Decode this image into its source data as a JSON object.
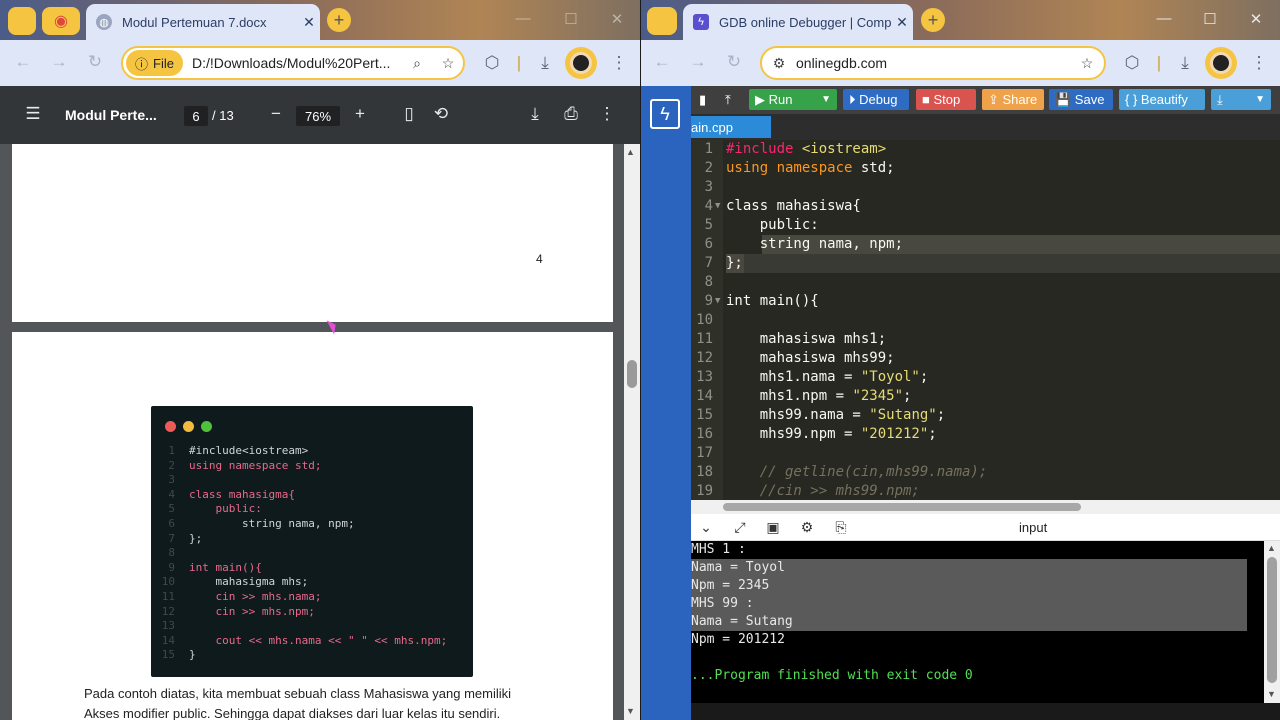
{
  "left": {
    "tab": {
      "title": "Modul Pertemuan 7.docx",
      "close": "✕"
    },
    "address": {
      "chip": "File",
      "url": "D:/!Downloads/Modul%20Pert..."
    },
    "pdf": {
      "doc_title": "Modul Perte...",
      "page_current": "6",
      "page_total": "/ 13",
      "zoom": "76%",
      "page_number_label": "4",
      "code_lines": [
        {
          "n": "1",
          "t": "#include<iostream>"
        },
        {
          "n": "2",
          "t": "using namespace std;"
        },
        {
          "n": "3",
          "t": ""
        },
        {
          "n": "4",
          "t": "class mahasigma{"
        },
        {
          "n": "5",
          "t": "    public:"
        },
        {
          "n": "6",
          "t": "        string nama, npm;"
        },
        {
          "n": "7",
          "t": "};"
        },
        {
          "n": "8",
          "t": ""
        },
        {
          "n": "9",
          "t": "int main(){"
        },
        {
          "n": "10",
          "t": "    mahasigma mhs;"
        },
        {
          "n": "11",
          "t": "    cin >> mhs.nama;"
        },
        {
          "n": "12",
          "t": "    cin >> mhs.npm;"
        },
        {
          "n": "13",
          "t": ""
        },
        {
          "n": "14",
          "t": "    cout << mhs.nama << \" \" << mhs.npm;"
        },
        {
          "n": "15",
          "t": "}"
        }
      ],
      "paragraph_line1": "Pada contoh diatas, kita membuat sebuah class Mahasiswa yang memiliki",
      "paragraph_line2": "Akses modifier public. Sehingga dapat diakses dari luar kelas itu sendiri."
    }
  },
  "right": {
    "tab": {
      "title": "GDB online Debugger | Compil",
      "close": "✕"
    },
    "address": {
      "url": "onlinegdb.com"
    },
    "toolbar": {
      "run": "▶ Run",
      "debug": "⏵ Debug",
      "stop": "■ Stop",
      "share": "⇪ Share",
      "save": "💾 Save",
      "beautify": "{ } Beautify"
    },
    "file_tab": "ain.cpp",
    "editor_lines": [
      {
        "n": "1",
        "parts": [
          {
            "c": "k",
            "t": "#include "
          },
          {
            "c": "s",
            "t": "<iostream>"
          }
        ]
      },
      {
        "n": "2",
        "parts": [
          {
            "c": "o",
            "t": "using namespace "
          },
          {
            "c": "pp",
            "t": "std;"
          }
        ]
      },
      {
        "n": "3",
        "parts": []
      },
      {
        "n": "4",
        "parts": [
          {
            "c": "pp",
            "t": "class mahasiswa{"
          }
        ]
      },
      {
        "n": "5",
        "parts": [
          {
            "c": "pp",
            "t": "    public:"
          }
        ]
      },
      {
        "n": "6",
        "parts": [
          {
            "c": "pp",
            "t": "    string nama, npm;"
          }
        ]
      },
      {
        "n": "7",
        "parts": [
          {
            "c": "pp",
            "t": "};"
          }
        ]
      },
      {
        "n": "8",
        "parts": []
      },
      {
        "n": "9",
        "parts": [
          {
            "c": "pp",
            "t": "int main(){"
          }
        ]
      },
      {
        "n": "10",
        "parts": []
      },
      {
        "n": "11",
        "parts": [
          {
            "c": "pp",
            "t": "    mahasiswa mhs1;"
          }
        ]
      },
      {
        "n": "12",
        "parts": [
          {
            "c": "pp",
            "t": "    mahasiswa mhs99;"
          }
        ]
      },
      {
        "n": "13",
        "parts": [
          {
            "c": "pp",
            "t": "    mhs1.nama = "
          },
          {
            "c": "s",
            "t": "\"Toyol\""
          },
          {
            "c": "pp",
            "t": ";"
          }
        ]
      },
      {
        "n": "14",
        "parts": [
          {
            "c": "pp",
            "t": "    mhs1.npm = "
          },
          {
            "c": "s",
            "t": "\"2345\""
          },
          {
            "c": "pp",
            "t": ";"
          }
        ]
      },
      {
        "n": "15",
        "parts": [
          {
            "c": "pp",
            "t": "    mhs99.nama = "
          },
          {
            "c": "s",
            "t": "\"Sutang\""
          },
          {
            "c": "pp",
            "t": ";"
          }
        ]
      },
      {
        "n": "16",
        "parts": [
          {
            "c": "pp",
            "t": "    mhs99.npm = "
          },
          {
            "c": "s",
            "t": "\"201212\""
          },
          {
            "c": "pp",
            "t": ";"
          }
        ]
      },
      {
        "n": "17",
        "parts": []
      },
      {
        "n": "18",
        "parts": [
          {
            "c": "cm",
            "t": "    // getline(cin,mhs99.nama);"
          }
        ]
      },
      {
        "n": "19",
        "parts": [
          {
            "c": "cm",
            "t": "    //cin >> mhs99.npm;"
          }
        ]
      }
    ],
    "io_label": "input",
    "console_lines": [
      "MHS 1 :",
      "Nama = Toyol",
      "Npm = 2345",
      "MHS 99 :",
      "Nama = Sutang",
      "Npm = 201212",
      "",
      "...Program finished with exit code 0"
    ]
  }
}
